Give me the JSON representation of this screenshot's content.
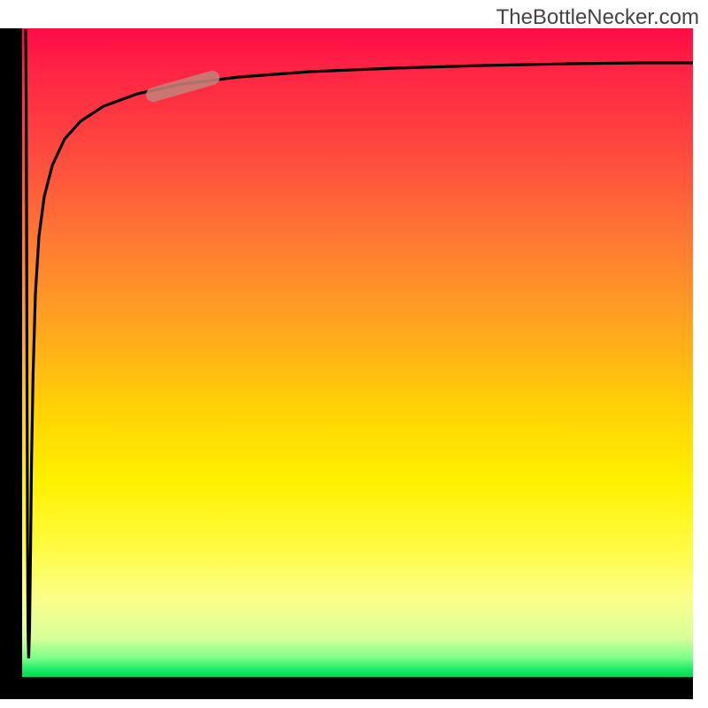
{
  "watermark": "TheBottleNecker.com",
  "colors": {
    "curve": "#000000",
    "marker": "#c6807a",
    "axis": "#000000"
  },
  "chart_data": {
    "type": "line",
    "title": "",
    "xlabel": "",
    "ylabel": "",
    "xlim": [
      0,
      100
    ],
    "ylim": [
      0,
      100
    ],
    "x": [
      0.2,
      0.5,
      0.8,
      1.0,
      1.3,
      1.6,
      2.0,
      2.6,
      3.3,
      4.2,
      5.3,
      6.7,
      8.5,
      11,
      14,
      18,
      23,
      29,
      36,
      45,
      56,
      68,
      80,
      90,
      100
    ],
    "values": [
      2,
      8,
      22,
      36,
      50,
      62,
      70,
      76,
      80,
      83,
      85,
      87,
      88.5,
      89.7,
      90.7,
      91.5,
      92.2,
      92.7,
      93.2,
      93.5,
      93.8,
      94.1,
      94.3,
      94.5,
      94.7
    ],
    "annotations": [
      {
        "type": "segment-highlight",
        "x_range": [
          20,
          28
        ],
        "color": "#c6807a"
      }
    ],
    "background_gradient": {
      "top": "#ff0b45",
      "mid": "#fff100",
      "bottom": "#06d455"
    }
  }
}
